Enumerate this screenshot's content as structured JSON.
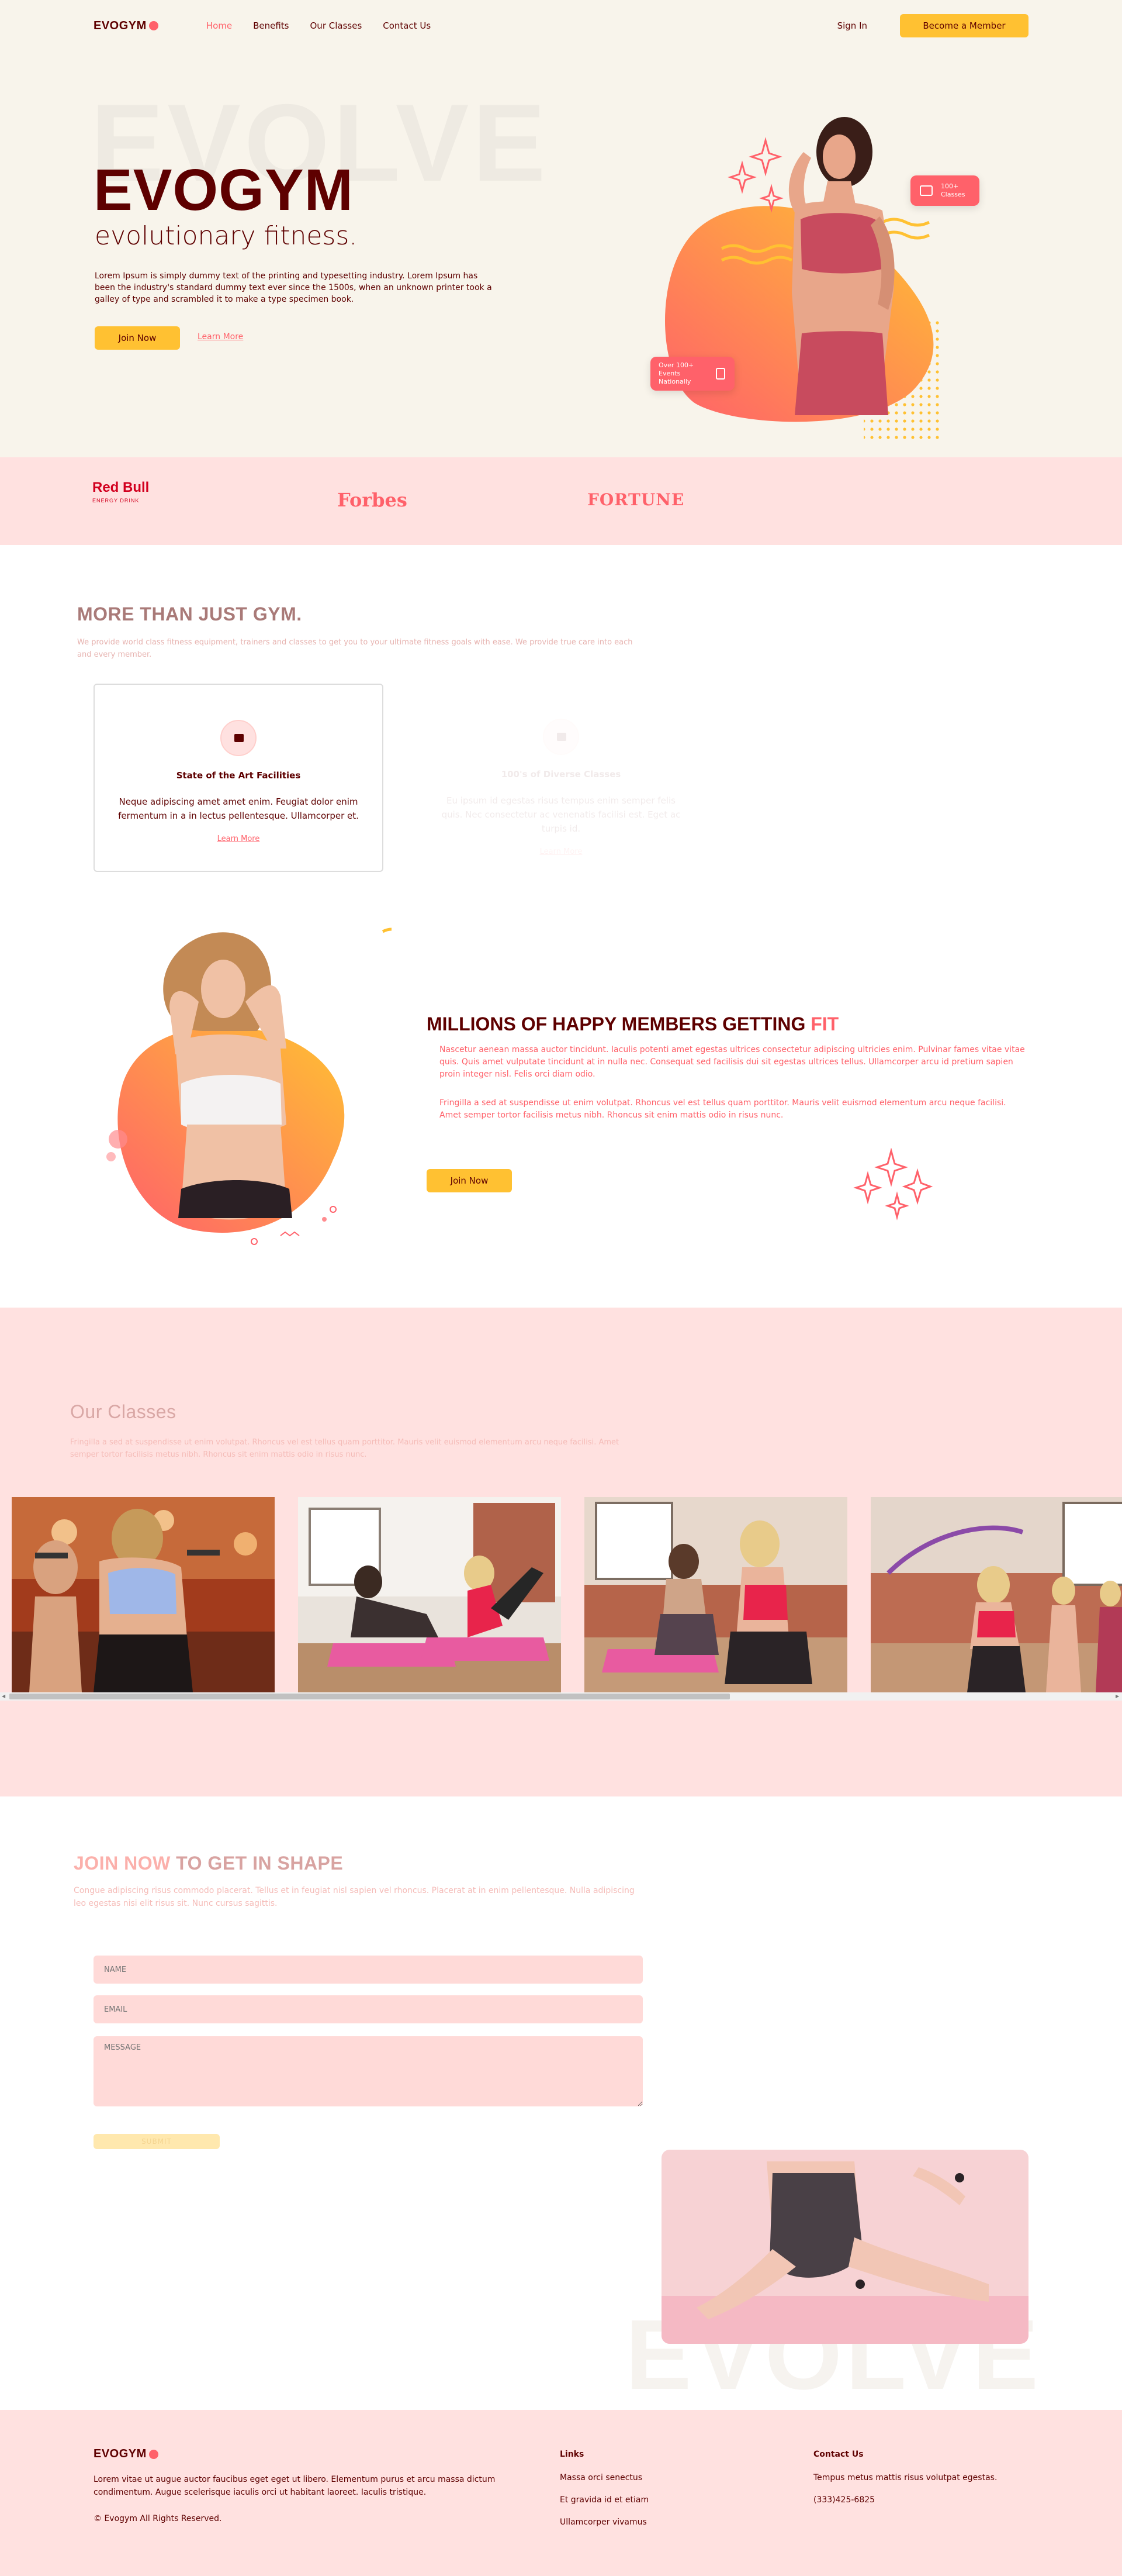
{
  "brand": {
    "logo_text": "EVOGYM",
    "colors": {
      "primary": "#FF616A",
      "dark": "#5E0000",
      "yellow": "#FFC132",
      "cream": "#F8F4EB",
      "pink_bg": "#FFE1E0"
    }
  },
  "nav": {
    "links": [
      "Home",
      "Benefits",
      "Our Classes",
      "Contact Us"
    ],
    "active": "Home",
    "sign_in": "Sign In",
    "cta": "Become a Member"
  },
  "hero": {
    "bg_word": "EVOLVE",
    "title": "EVOGYM",
    "subtitle": "evolutionary fitness.",
    "text": "Lorem Ipsum is simply dummy text of the printing and typesetting industry. Lorem Ipsum has been the industry's standard dummy text ever since the 1500s, when an unknown printer took a galley of type and scrambled it to make a type specimen book.",
    "join_label": "Join Now",
    "learn_label": "Learn More",
    "badge_classes": [
      "100+",
      "Classes"
    ],
    "badge_events": [
      "Over 100+",
      "Events Nationally"
    ]
  },
  "sponsors": {
    "redbull": "Red Bull",
    "redbull_sub": "ENERGY DRINK",
    "forbes": "Forbes",
    "fortune": "FORTUNE"
  },
  "benefits": {
    "title": "MORE THAN JUST GYM.",
    "text": "We provide world class fitness equipment, trainers and classes to get you to your ultimate fitness goals with ease. We provide true care into each and every member.",
    "cards": [
      {
        "title": "State of the Art Facilities",
        "text": "Neque adipiscing amet amet enim. Feugiat dolor enim fermentum in a in lectus pellentesque. Ullamcorper et.",
        "link": "Learn More"
      },
      {
        "title": "100's of Diverse Classes",
        "text": "Eu ipsum id egestas risus tempus enim semper felis quis. Nec consectetur ac venenatis facilisi est. Eget ac turpis id.",
        "link": "Learn More"
      }
    ]
  },
  "happy": {
    "title_main": "MILLIONS OF HAPPY MEMBERS GETTING ",
    "title_accent": "FIT",
    "p1": "Nascetur aenean massa auctor tincidunt. Iaculis potenti amet egestas ultrices consectetur adipiscing ultricies enim. Pulvinar fames vitae vitae quis. Quis amet vulputate tincidunt at in nulla nec. Consequat sed facilisis dui sit egestas ultrices tellus. Ullamcorper arcu id pretium sapien proin integer nisl. Felis orci diam odio.",
    "p2": "Fringilla a sed at suspendisse ut enim volutpat. Rhoncus vel est tellus quam porttitor. Mauris velit euismod elementum arcu neque facilisi. Amet semper tortor facilisis metus nibh. Rhoncus sit enim mattis odio in risus nunc.",
    "join_label": "Join Now"
  },
  "classes": {
    "title": "Our Classes",
    "text": "Fringilla a sed at suspendisse ut enim volutpat. Rhoncus vel est tellus quam porttitor. Mauris velit euismod elementum arcu neque facilisi. Amet semper tortor facilisis metus nibh. Rhoncus sit enim mattis odio in risus nunc."
  },
  "contact": {
    "title_accent": "JOIN NOW",
    "title_main": " TO GET IN SHAPE",
    "text": "Congue adipiscing risus commodo placerat. Tellus et in feugiat nisl sapien vel rhoncus. Placerat at in enim pellentesque. Nulla adipiscing leo egestas nisi elit risus sit. Nunc cursus sagittis.",
    "name_placeholder": "NAME",
    "email_placeholder": "EMAIL",
    "message_placeholder": "MESSAGE",
    "submit_label": "SUBMIT",
    "bg_word": "EVOLVE"
  },
  "footer": {
    "logo_text": "EVOGYM",
    "text": "Lorem vitae ut augue auctor faucibus eget eget ut libero. Elementum purus et arcu massa dictum condimentum. Augue scelerisque iaculis orci ut habitant laoreet. Iaculis tristique.",
    "copyright": "© Evogym All Rights Reserved.",
    "links_title": "Links",
    "links": [
      "Massa orci senectus",
      "Et gravida id et etiam",
      "Ullamcorper vivamus"
    ],
    "contact_title": "Contact Us",
    "contact_text": "Tempus metus mattis risus volutpat egestas.",
    "phone": "(333)425-6825"
  }
}
